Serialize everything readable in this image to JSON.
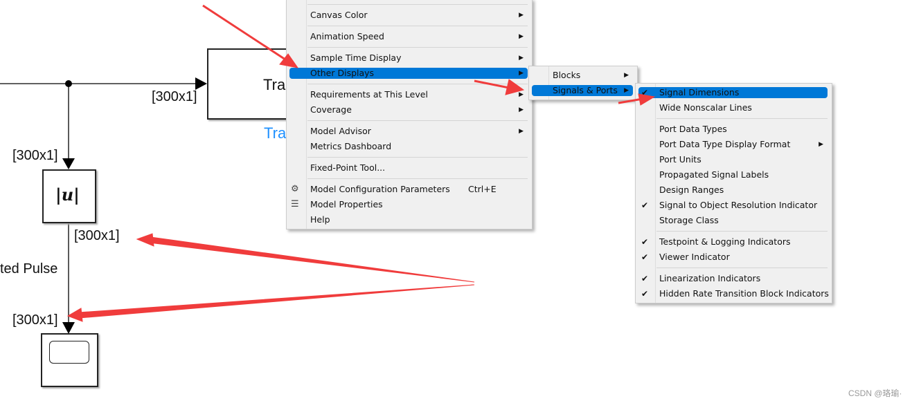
{
  "diagram": {
    "dim_labels": [
      "[300x1]",
      "[300x1]",
      "[300x1]",
      "[300x1]"
    ],
    "block_tra_text": "Tra",
    "block_tra_name": "Tra",
    "abs_block_text": "|u|",
    "pulse_label": "ted Pulse"
  },
  "main_menu": {
    "items": [
      {
        "label": "Canvas Color",
        "submenu": true
      },
      {
        "label": "Animation Speed",
        "submenu": true
      },
      {
        "label": "Sample Time Display",
        "submenu": true
      },
      {
        "label": "Other Displays",
        "submenu": true,
        "highlighted": true
      },
      {
        "label": "Requirements at This Level",
        "submenu": true
      },
      {
        "label": "Coverage",
        "submenu": true
      },
      {
        "label": "Model Advisor",
        "submenu": true
      },
      {
        "label": "Metrics Dashboard"
      },
      {
        "label": "Fixed-Point Tool..."
      },
      {
        "label": "Model Configuration Parameters",
        "shortcut": "Ctrl+E",
        "icon": "gear-icon"
      },
      {
        "label": "Model Properties",
        "icon": "properties-list-icon"
      },
      {
        "label": "Help"
      }
    ]
  },
  "other_displays_menu": {
    "items": [
      {
        "label": "Blocks",
        "submenu": true
      },
      {
        "label": "Signals & Ports",
        "submenu": true,
        "highlighted": true
      }
    ]
  },
  "signals_ports_menu": {
    "items": [
      {
        "label": "Signal Dimensions",
        "checked": true,
        "highlighted": true
      },
      {
        "label": "Wide Nonscalar Lines",
        "checked": false
      },
      {
        "label": "Port Data Types",
        "checked": false
      },
      {
        "label": "Port Data Type Display Format",
        "submenu": true
      },
      {
        "label": "Port Units",
        "checked": false
      },
      {
        "label": "Propagated Signal Labels",
        "checked": false
      },
      {
        "label": "Design Ranges",
        "checked": false
      },
      {
        "label": "Signal to Object Resolution Indicator",
        "checked": true
      },
      {
        "label": "Storage Class",
        "checked": false
      },
      {
        "label": "Testpoint & Logging Indicators",
        "checked": true
      },
      {
        "label": "Viewer Indicator",
        "checked": true
      },
      {
        "label": "Linearization Indicators",
        "checked": true
      },
      {
        "label": "Hidden Rate Transition Block Indicators",
        "checked": true
      }
    ]
  },
  "symbols": {
    "arrow": "▶",
    "check": "✔",
    "gear": "⚙",
    "list": "☰"
  },
  "colors": {
    "highlight": "#0078d7",
    "annotation_arrow": "#f03c3c",
    "block_name": "#1e90ff"
  },
  "watermark": "CSDN @珞瑜·"
}
